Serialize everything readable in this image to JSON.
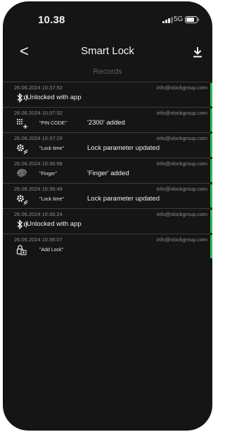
{
  "status_bar": {
    "time": "10.38",
    "network": "5G"
  },
  "header": {
    "back_glyph": "<",
    "title": "Smart Lock",
    "download_icon": "download-icon"
  },
  "subtitle": "Records",
  "records": [
    {
      "timestamp": "26.06.2024 10:37:52",
      "email": "info@xlockgroup.com",
      "icon": "bluetooth-icon",
      "param": "",
      "message": "Unlocked with app",
      "highlighted": true
    },
    {
      "timestamp": "26.06.2024 10:37:32",
      "email": "info@xlockgroup.com",
      "icon": "keypad-add-icon",
      "param": "\"PIN CODE\"",
      "message": "'2300' added",
      "highlighted": true
    },
    {
      "timestamp": "26.06.2024 10:37:29",
      "email": "info@xlockgroup.com",
      "icon": "settings-edit-icon",
      "param": "\"Lock time\"",
      "message": "Lock parameter updated",
      "highlighted": true
    },
    {
      "timestamp": "26.06.2024 10:36:58",
      "email": "info@xlockgroup.com",
      "icon": "fingerprint-icon",
      "param": "\"Finger\"",
      "message": "'Finger' added",
      "highlighted": true
    },
    {
      "timestamp": "26.06.2024 10:36:49",
      "email": "info@xlockgroup.com",
      "icon": "settings-edit-icon",
      "param": "\"Lock time\"",
      "message": "Lock parameter updated",
      "highlighted": true
    },
    {
      "timestamp": "26.06.2024 10:36:24",
      "email": "info@xlockgroup.com",
      "icon": "bluetooth-icon",
      "param": "",
      "message": "Unlocked with app",
      "highlighted": true
    },
    {
      "timestamp": "26.06.2024 10:36:07",
      "email": "info@xlockgroup.com",
      "icon": "lock-add-icon",
      "param": "\"Add Lock\"",
      "message": "",
      "highlighted": true
    }
  ],
  "colors": {
    "background": "#151515",
    "accent": "#35b84f",
    "divider": "#3b3b3b",
    "muted_text": "#8e8e8e"
  }
}
